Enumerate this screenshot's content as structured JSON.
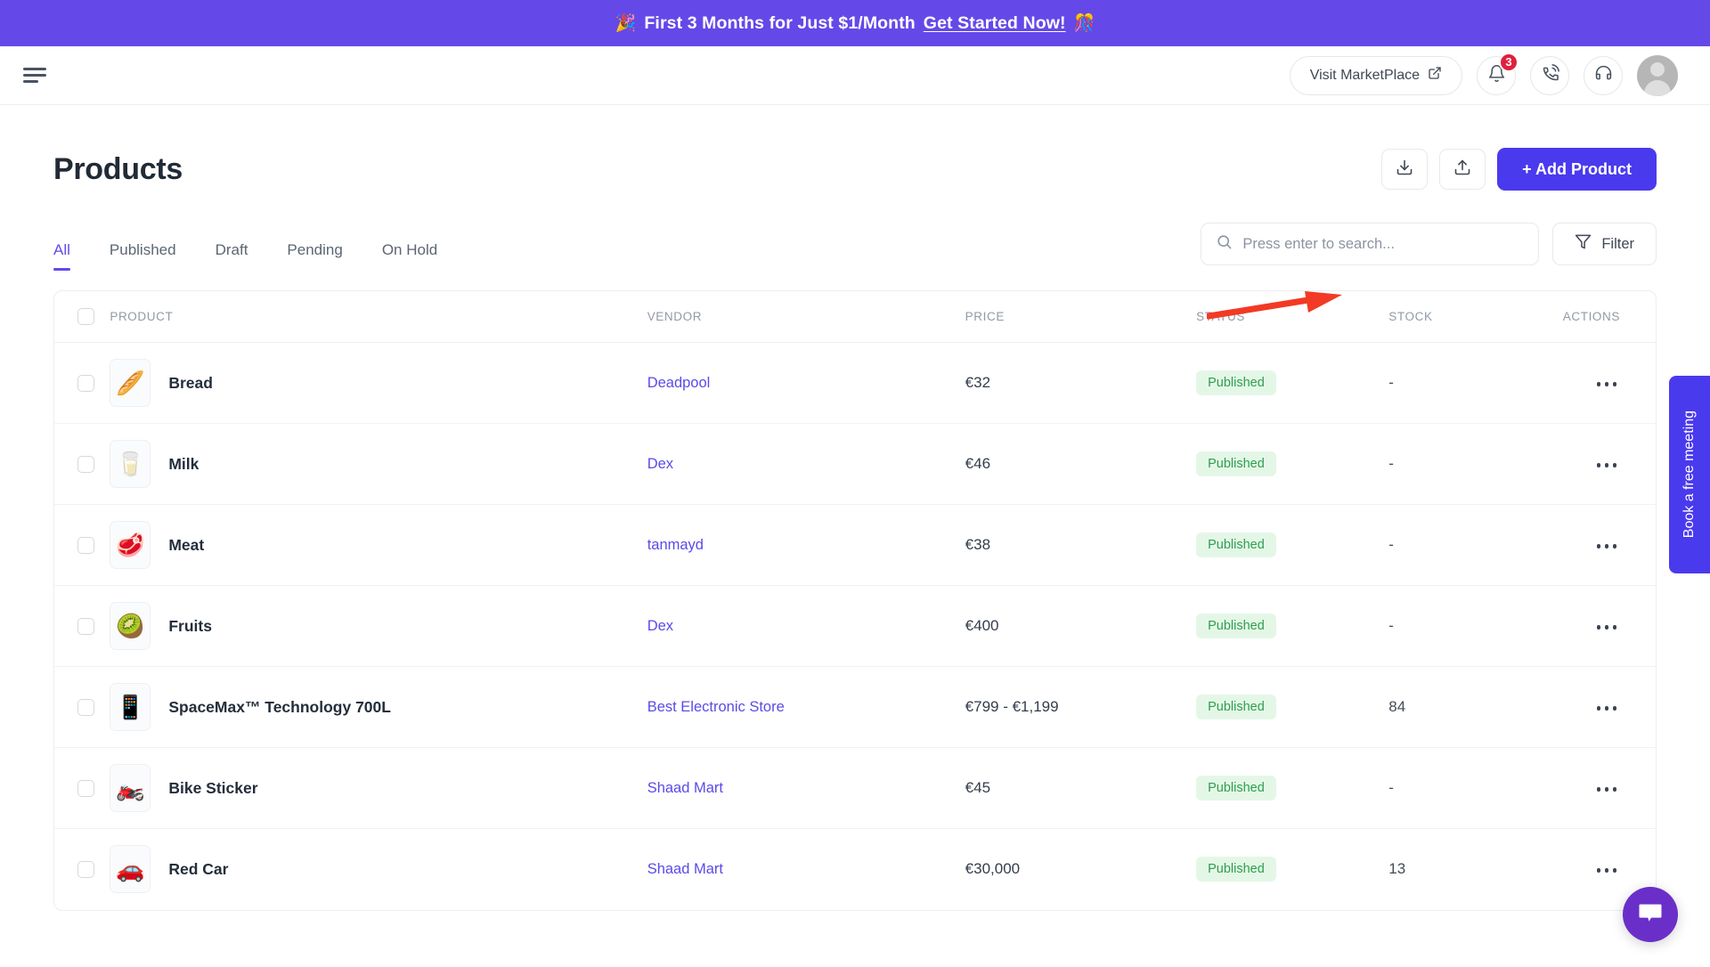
{
  "banner": {
    "emoji_left": "🎉",
    "text": "First 3 Months for Just $1/Month",
    "link_label": "Get Started Now!",
    "emoji_right": "🎊",
    "background": "#6548e8"
  },
  "topbar": {
    "menu_icon": "hamburger-icon",
    "marketplace_label": "Visit MarketPlace",
    "marketplace_icon": "external-link-icon",
    "notification_icon": "bell-icon",
    "notification_count": "3",
    "notification_badge_color": "#e0203d",
    "call_icon": "phone-ring-icon",
    "support_icon": "headset-icon",
    "avatar_label": "user-avatar"
  },
  "page": {
    "title": "Products",
    "download_label": "download-icon",
    "upload_label": "upload-icon",
    "add_product_label": "+  Add Product",
    "add_product_color": "#4a3aed"
  },
  "tabs": [
    {
      "label": "All",
      "active": true
    },
    {
      "label": "Published",
      "active": false
    },
    {
      "label": "Draft",
      "active": false
    },
    {
      "label": "Pending",
      "active": false
    },
    {
      "label": "On Hold",
      "active": false
    }
  ],
  "search": {
    "placeholder": "Press enter to search...",
    "value": "",
    "icon": "search-icon"
  },
  "filter": {
    "label": "Filter",
    "icon": "funnel-icon"
  },
  "table": {
    "columns": [
      "PRODUCT",
      "VENDOR",
      "PRICE",
      "STATUS",
      "STOCK",
      "ACTIONS"
    ],
    "rows": [
      {
        "thumb": "🥖",
        "name": "Bread",
        "vendor": "Deadpool",
        "price": "€32",
        "status": "Published",
        "stock": "-"
      },
      {
        "thumb": "🥛",
        "name": "Milk",
        "vendor": "Dex",
        "price": "€46",
        "status": "Published",
        "stock": "-"
      },
      {
        "thumb": "🥩",
        "name": "Meat",
        "vendor": "tanmayd",
        "price": "€38",
        "status": "Published",
        "stock": "-"
      },
      {
        "thumb": "🥝",
        "name": "Fruits",
        "vendor": "Dex",
        "price": "€400",
        "status": "Published",
        "stock": "-"
      },
      {
        "thumb": "📱",
        "name": "SpaceMax™ Technology 700L",
        "vendor": "Best Electronic Store",
        "price": "€799 - €1,199",
        "status": "Published",
        "stock": "84"
      },
      {
        "thumb": "🏍️",
        "name": "Bike Sticker",
        "vendor": "Shaad Mart",
        "price": "€45",
        "status": "Published",
        "stock": "-"
      },
      {
        "thumb": "🚗",
        "name": "Red Car",
        "vendor": "Shaad Mart",
        "price": "€30,000",
        "status": "Published",
        "stock": "13"
      }
    ],
    "status_colors": {
      "published_bg": "#e4f7e7",
      "published_text": "#2e9e4f"
    }
  },
  "meeting_tab": {
    "label": "Book a free meeting",
    "color": "#4a3aed"
  },
  "chat": {
    "icon": "chat-bubble-icon",
    "color": "#6b2fc9"
  }
}
